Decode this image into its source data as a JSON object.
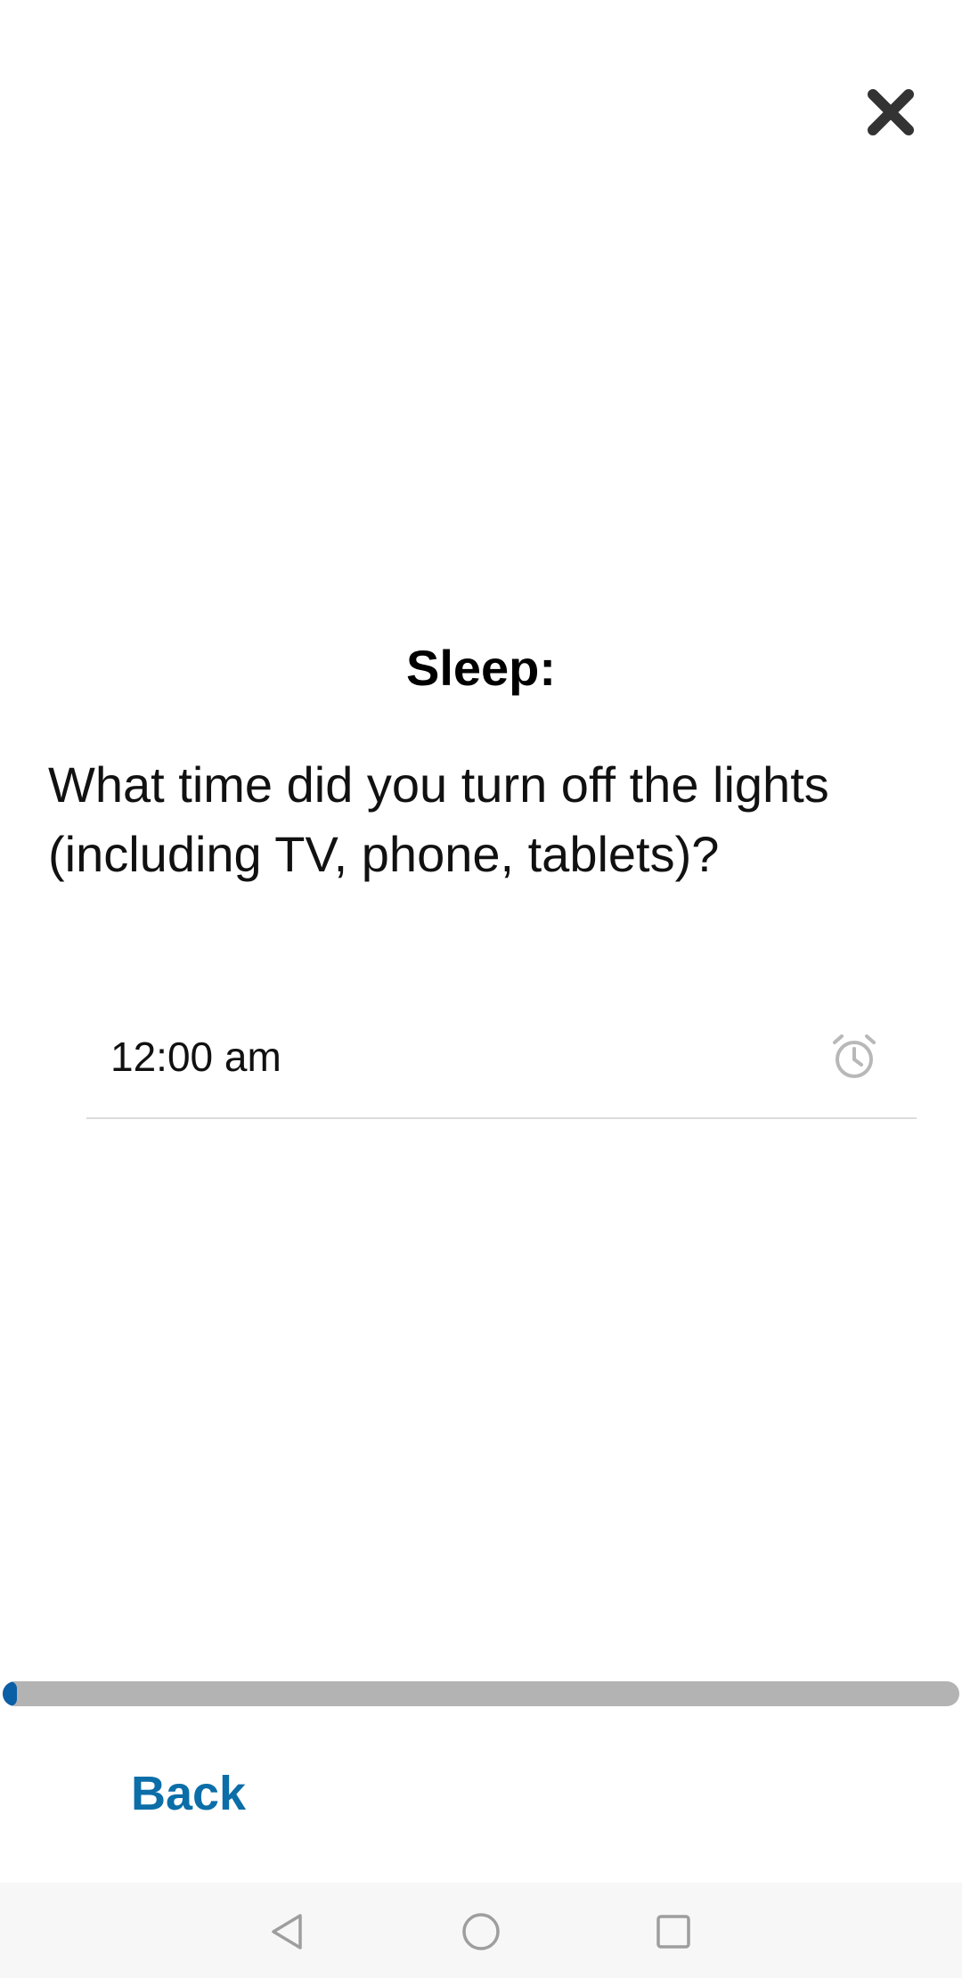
{
  "header": {
    "close_icon": "close-icon"
  },
  "question": {
    "section_title": "Sleep:",
    "text": "What time did you turn off the lights (including TV, phone, tablets)?"
  },
  "time_input": {
    "value": "12:00 am",
    "icon": "alarm-clock-icon"
  },
  "progress": {
    "fraction": 0.015,
    "fill_color": "#0b5fa5",
    "track_color": "#b3b3b3"
  },
  "footer": {
    "back_label": "Back",
    "back_color": "#0b6ea8"
  },
  "system_nav": {
    "items": [
      "back-triangle-icon",
      "home-circle-icon",
      "recents-square-icon"
    ]
  }
}
